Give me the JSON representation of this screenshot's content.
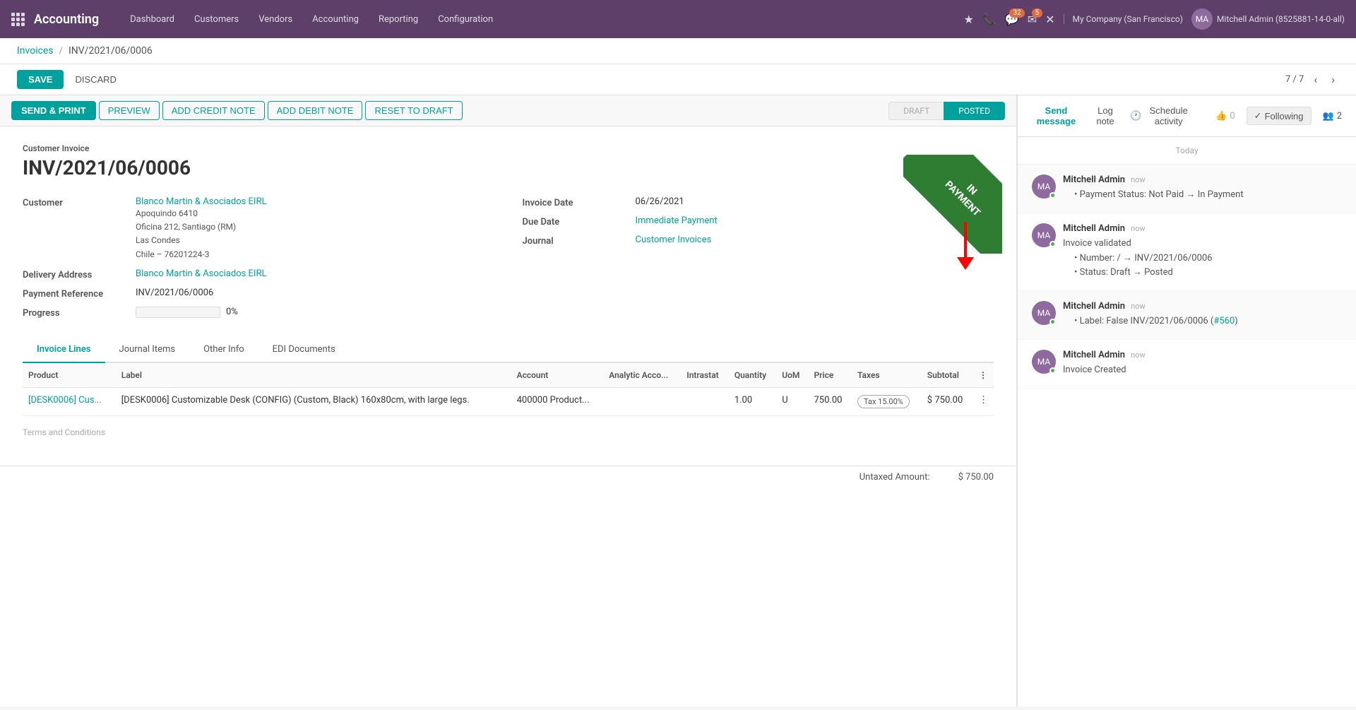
{
  "app": {
    "name": "Accounting"
  },
  "nav": {
    "items": [
      {
        "label": "Dashboard"
      },
      {
        "label": "Customers"
      },
      {
        "label": "Vendors"
      },
      {
        "label": "Accounting"
      },
      {
        "label": "Reporting"
      },
      {
        "label": "Configuration"
      }
    ],
    "icons": {
      "bell": "🔔",
      "phone": "📞",
      "chat_count": "32",
      "message_count": "5",
      "close": "✕"
    },
    "company": "My Company (San Francisco)",
    "user": "Mitchell Admin (8525881-14-0-all)"
  },
  "breadcrumb": {
    "parent": "Invoices",
    "current": "INV/2021/06/0006"
  },
  "actions": {
    "save": "SAVE",
    "discard": "DISCARD",
    "pagination": "7 / 7"
  },
  "toolbar": {
    "send_print": "SEND & PRINT",
    "preview": "PREVIEW",
    "add_credit_note": "ADD CREDIT NOTE",
    "add_debit_note": "ADD DEBIT NOTE",
    "reset_to_draft": "RESET TO DRAFT",
    "status_draft": "DRAFT",
    "status_posted": "POSTED"
  },
  "invoice": {
    "type_label": "Customer Invoice",
    "number": "INV/2021/06/0006",
    "in_payment_label": "IN\nPAYMENT",
    "customer_label": "Customer",
    "customer_name": "Blanco Martin & Asociados EIRL",
    "customer_address_line1": "Apoquindo 6410",
    "customer_address_line2": "Oficina 212, Santiago (RM)",
    "customer_address_line3": "Las Condes",
    "customer_address_line4": "Chile – 76201224-3",
    "delivery_address_label": "Delivery Address",
    "delivery_address": "Blanco Martin & Asociados EIRL",
    "payment_ref_label": "Payment Reference",
    "payment_ref": "INV/2021/06/0006",
    "progress_label": "Progress",
    "progress_pct": "0%",
    "invoice_date_label": "Invoice Date",
    "invoice_date": "06/26/2021",
    "due_date_label": "Due Date",
    "due_date": "Immediate Payment",
    "journal_label": "Journal",
    "journal": "Customer Invoices"
  },
  "tabs": [
    {
      "label": "Invoice Lines",
      "id": "invoice-lines"
    },
    {
      "label": "Journal Items",
      "id": "journal-items"
    },
    {
      "label": "Other Info",
      "id": "other-info"
    },
    {
      "label": "EDI Documents",
      "id": "edi-documents"
    }
  ],
  "table": {
    "columns": [
      {
        "label": "Product"
      },
      {
        "label": "Label"
      },
      {
        "label": "Account"
      },
      {
        "label": "Analytic Acco..."
      },
      {
        "label": "Intrastat"
      },
      {
        "label": "Quantity"
      },
      {
        "label": "UoM"
      },
      {
        "label": "Price"
      },
      {
        "label": "Taxes"
      },
      {
        "label": "Subtotal"
      }
    ],
    "rows": [
      {
        "product": "[DESK0006] Cus...",
        "label": "[DESK0006] Customizable Desk (CONFIG) (Custom, Black) 160x80cm, with large legs.",
        "account": "400000 Product...",
        "analytic": "",
        "intrastat": "",
        "quantity": "1.00",
        "uom": "U",
        "price": "750.00",
        "taxes": "Tax 15.00%",
        "subtotal": "$ 750.00"
      }
    ]
  },
  "footer": {
    "terms_label": "Terms and Conditions",
    "untaxed_label": "Untaxed Amount:",
    "untaxed_value": "$ 750.00"
  },
  "chatter": {
    "send_message": "Send message",
    "log_note": "Log note",
    "schedule_activity": "Schedule activity",
    "following_label": "Following",
    "followers_count": "2",
    "likes_count": "0",
    "today_label": "Today",
    "messages": [
      {
        "author": "Mitchell Admin",
        "time": "now",
        "body": "Payment Status: Not Paid → In Payment",
        "bullet": true
      },
      {
        "author": "Mitchell Admin",
        "time": "now",
        "body_lines": [
          "Invoice validated",
          "Number: / → INV/2021/06/0006",
          "Status: Draft → Posted"
        ]
      },
      {
        "author": "Mitchell Admin",
        "time": "now",
        "body_lines": [
          "Label: False  INV/2021/06/0006 (#560)"
        ],
        "link": "#560"
      },
      {
        "author": "Mitchell Admin",
        "time": "now",
        "body_lines": [
          "Invoice Created"
        ]
      }
    ]
  }
}
